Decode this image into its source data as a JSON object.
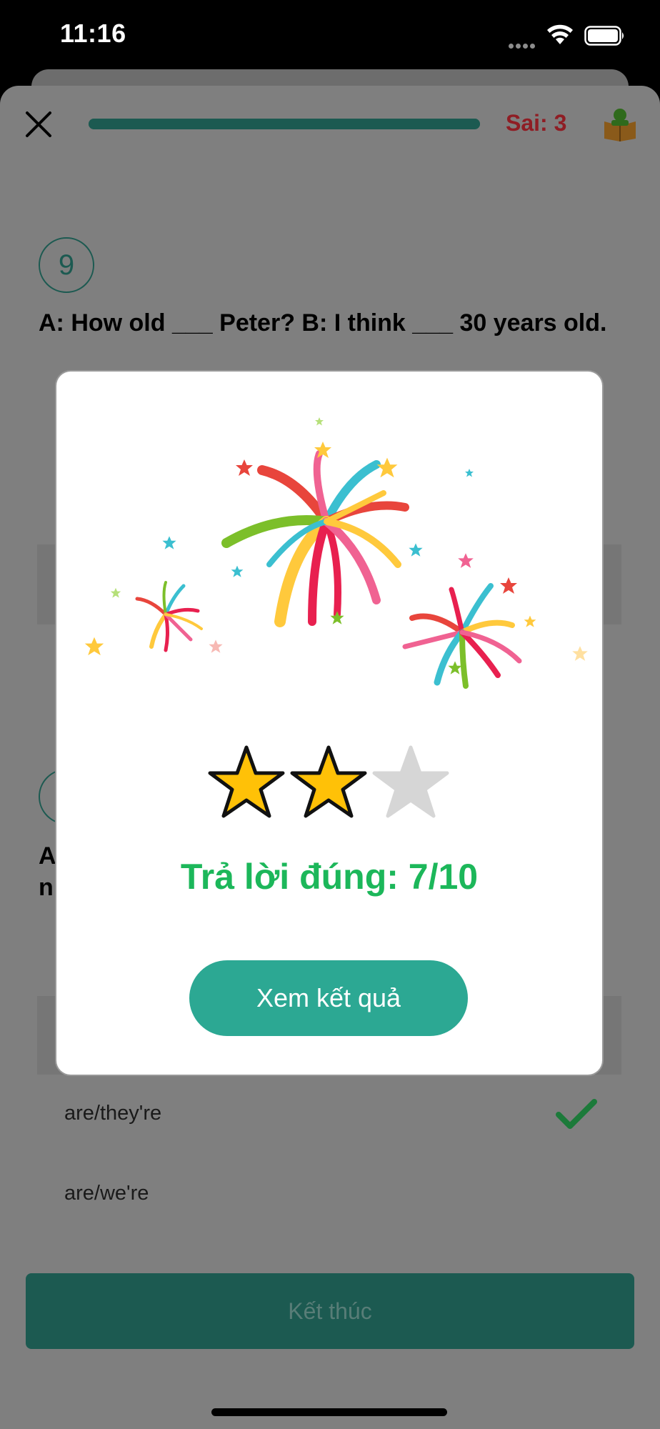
{
  "status_bar": {
    "time": "11:16"
  },
  "header": {
    "wrong_count": "Sai: 3",
    "progress": 1.0
  },
  "question9": {
    "number": "9",
    "text": "A: How old ___ Peter? B: I think ___ 30 years old."
  },
  "question10": {
    "number_partial": "1",
    "text_line1_partial": "A",
    "text_line2_partial": "n"
  },
  "options": [
    {
      "label": "are/they're",
      "correct": true
    },
    {
      "label": "are/we're",
      "correct": false
    }
  ],
  "finish_button": "Kết thúc",
  "result_modal": {
    "stars_earned": 2,
    "stars_total": 3,
    "score_text": "Trả lời đúng: 7/10",
    "view_results_button": "Xem kết quả"
  },
  "colors": {
    "accent_dark": "#1c5a51",
    "accent_teal": "#2ca893",
    "success_green": "#1cb75a",
    "error_red": "#8f1d24",
    "star_gold": "#ffc107"
  }
}
